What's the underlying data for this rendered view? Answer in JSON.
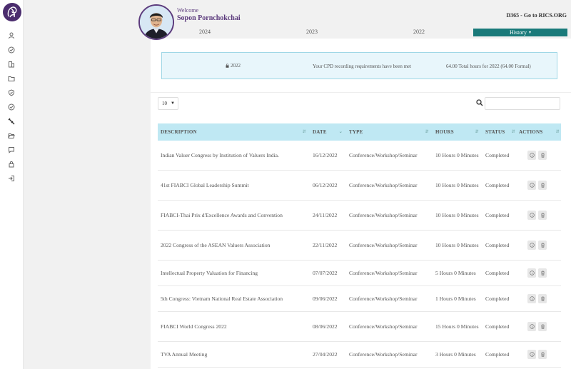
{
  "header": {
    "welcome": "Welcome",
    "user_name": "Sopon Pornchokchai",
    "rics_link": "D365 - Go to RICS.ORG"
  },
  "year_tabs": [
    "2024",
    "2023",
    "2022"
  ],
  "history_button": "History",
  "summary": {
    "year": "2022",
    "message": "Your CPD recording requirements have been met",
    "hours": "64.00 Total hours for 2022 (64.00 Formal)"
  },
  "page_size": "10",
  "table": {
    "headers": [
      "DESCRIPTION",
      "DATE",
      "TYPE",
      "HOURS",
      "STATUS",
      "ACTIONS"
    ],
    "rows": [
      {
        "description": "Indian Valuer Congress by Institution of Valuers India.",
        "date": "16/12/2022",
        "type": "Conference/Workshop/Seminar",
        "hours": "10 Hours 0 Minutes",
        "status": "Completed"
      },
      {
        "description": "41st FIABCI Global Leadership Summit",
        "date": "06/12/2022",
        "type": "Conference/Workshop/Seminar",
        "hours": "10 Hours 0 Minutes",
        "status": "Completed"
      },
      {
        "description": "FIABCI-Thai Prix d'Excellence Awards and Convention",
        "date": "24/11/2022",
        "type": "Conference/Workshop/Seminar",
        "hours": "10 Hours 0 Minutes",
        "status": "Completed"
      },
      {
        "description": "2022 Congress of the ASEAN Valuers Association",
        "date": "22/11/2022",
        "type": "Conference/Workshop/Seminar",
        "hours": "10 Hours 0 Minutes",
        "status": "Completed"
      },
      {
        "description": "Intellectual Property Valuation for Financing",
        "date": "07/07/2022",
        "type": "Conference/Workshop/Seminar",
        "hours": "5 Hours 0 Minutes",
        "status": "Completed"
      },
      {
        "description": "5th Congress: Vietnam National Real Estate Association",
        "date": "09/06/2022",
        "type": "Conference/Workshop/Seminar",
        "hours": "1 Hours 0 Minutes",
        "status": "Completed"
      },
      {
        "description": "FIABCI World Congress 2022",
        "date": "08/06/2022",
        "type": "Conference/Workshop/Seminar",
        "hours": "15 Hours 0 Minutes",
        "status": "Completed"
      },
      {
        "description": "TVA Annual Meeting",
        "date": "27/04/2022",
        "type": "Conference/Workshop/Seminar",
        "hours": "3 Hours 0 Minutes",
        "status": "Completed"
      }
    ]
  }
}
